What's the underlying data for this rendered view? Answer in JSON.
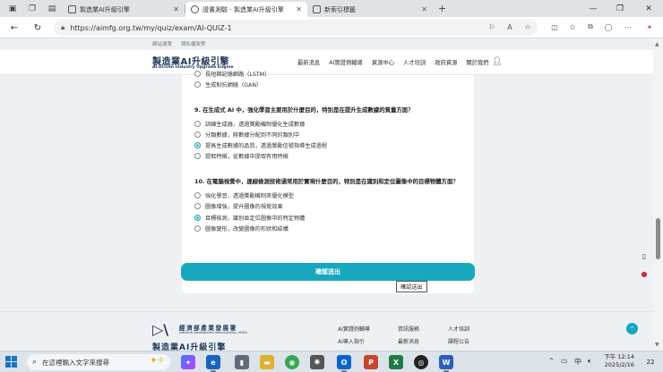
{
  "browser": {
    "tabs": [
      {
        "title": "製造業AI升級引擎",
        "active": false
      },
      {
        "title": "證書測驗 - 製造業AI升級引擎",
        "active": true
      },
      {
        "title": "新索引標籤",
        "active": false
      }
    ],
    "url": "https://aimfg.org.tw/my/quiz/exam/AI-QUIZ-1"
  },
  "site": {
    "top_links": [
      "網站導覽",
      "隱私權政策"
    ],
    "logo_title": "製造業AI升級引擎",
    "logo_subtitle": "AI-Driven Industry Upgrade Engine",
    "nav": [
      "最新消息",
      "AI實證例輔導",
      "資源中心",
      "人才培訓",
      "政府資源",
      "關於我們"
    ]
  },
  "quiz": {
    "partial_options": [
      {
        "label": "長短期記憶網路（LSTM）",
        "selected": false
      },
      {
        "label": "生成對抗網絡（GAN）",
        "selected": false
      }
    ],
    "questions": [
      {
        "text": "9. 在生成式 AI 中，強化學習主要用於什麼目的，特別是在提升生成數據的質量方面？",
        "options": [
          {
            "label": "訓練生成器，透過獎勵機制優化生成數據",
            "selected": false
          },
          {
            "label": "分類數據，將數據分配到不同的類別中",
            "selected": false
          },
          {
            "label": "提高生成數據的品質，透過獎勵信號指導生成過程",
            "selected": true
          },
          {
            "label": "提取特徵，從數據中提取有用特徵",
            "selected": false
          }
        ]
      },
      {
        "text": "10. 在電腦視覺中，連線檢測技術通常用於實現什麼目的，特別是在識別和定位圖像中的目標物體方面？",
        "options": [
          {
            "label": "強化學習，透過獎勵機制來優化模型",
            "selected": false
          },
          {
            "label": "圖像增強，提升圖像的視覺效果",
            "selected": false
          },
          {
            "label": "目標檢測，識別並定位圖像中的特定物體",
            "selected": true
          },
          {
            "label": "圖像變形，改變圖像的形狀和結構",
            "selected": false
          }
        ]
      }
    ],
    "submit_label": "確認送出",
    "tooltip": "確認送出"
  },
  "footer": {
    "org_name": "經濟部產業發展署",
    "org_name_en": "Industrial Development Administration, MOEA",
    "title": "製造業AI升級引擎",
    "links": [
      [
        "AI實證例輔導",
        "資訊服務",
        "人才培訓"
      ],
      [
        "AI導入指引",
        "最新消息",
        "課程公告"
      ]
    ]
  },
  "taskbar": {
    "search_placeholder": "在這裡輸入文字來搜尋",
    "ime": "中",
    "time": "下午 12:14",
    "date": "2025/2/16",
    "notification_count": "22"
  },
  "colors": {
    "accent": "#17a8c0",
    "brand_navy": "#1b3558"
  }
}
